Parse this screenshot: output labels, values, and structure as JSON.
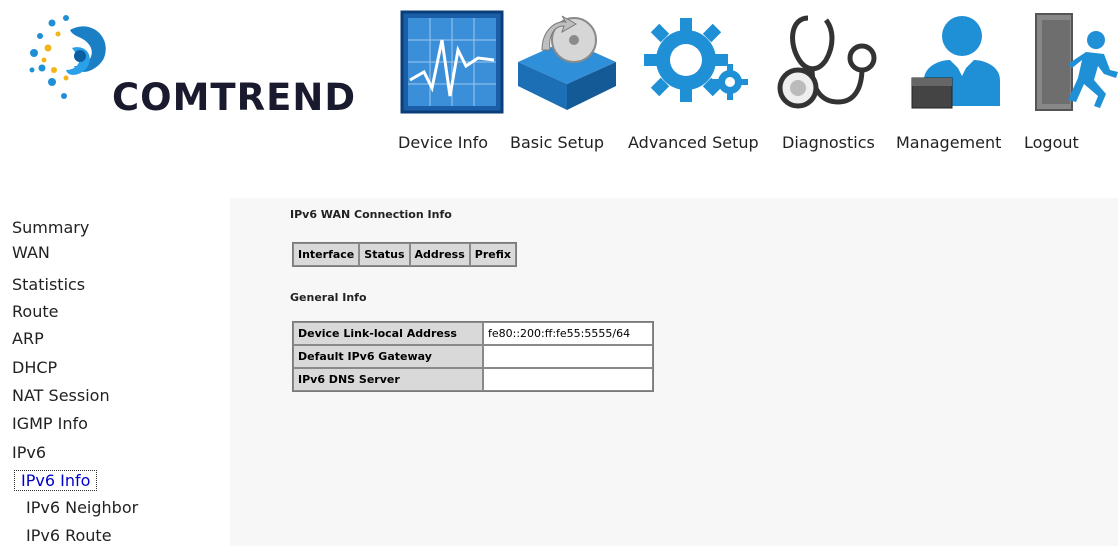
{
  "brand": {
    "name": "COMTREND"
  },
  "nav": [
    {
      "label": "Device Info",
      "icon": "device-info-icon"
    },
    {
      "label": "Basic Setup",
      "icon": "basic-setup-icon"
    },
    {
      "label": "Advanced Setup",
      "icon": "advanced-setup-icon"
    },
    {
      "label": "Diagnostics",
      "icon": "diagnostics-icon"
    },
    {
      "label": "Management",
      "icon": "management-icon"
    },
    {
      "label": "Logout",
      "icon": "logout-icon"
    }
  ],
  "sidebar": {
    "items": [
      {
        "label": "Summary"
      },
      {
        "label": "WAN"
      },
      {
        "label": "Statistics"
      },
      {
        "label": "Route"
      },
      {
        "label": "ARP"
      },
      {
        "label": "DHCP"
      },
      {
        "label": "NAT Session"
      },
      {
        "label": "IGMP Info"
      },
      {
        "label": "IPv6"
      },
      {
        "label": "IPv6 Info",
        "active": true
      },
      {
        "label": "IPv6 Neighbor"
      },
      {
        "label": "IPv6 Route"
      }
    ]
  },
  "main": {
    "wan_heading": "IPv6 WAN Connection Info",
    "wan_columns": [
      "Interface",
      "Status",
      "Address",
      "Prefix"
    ],
    "general_heading": "General Info",
    "general_rows": [
      {
        "label": "Device Link-local Address",
        "value": "fe80::200:ff:fe55:5555/64"
      },
      {
        "label": "Default IPv6 Gateway",
        "value": ""
      },
      {
        "label": "IPv6 DNS Server",
        "value": ""
      }
    ]
  },
  "colors": {
    "content_bg": "#f7f7f7",
    "header_cell_bg": "#d9d9d9",
    "active_link": "#0000cc",
    "icon_blue": "#1f8fd6"
  }
}
